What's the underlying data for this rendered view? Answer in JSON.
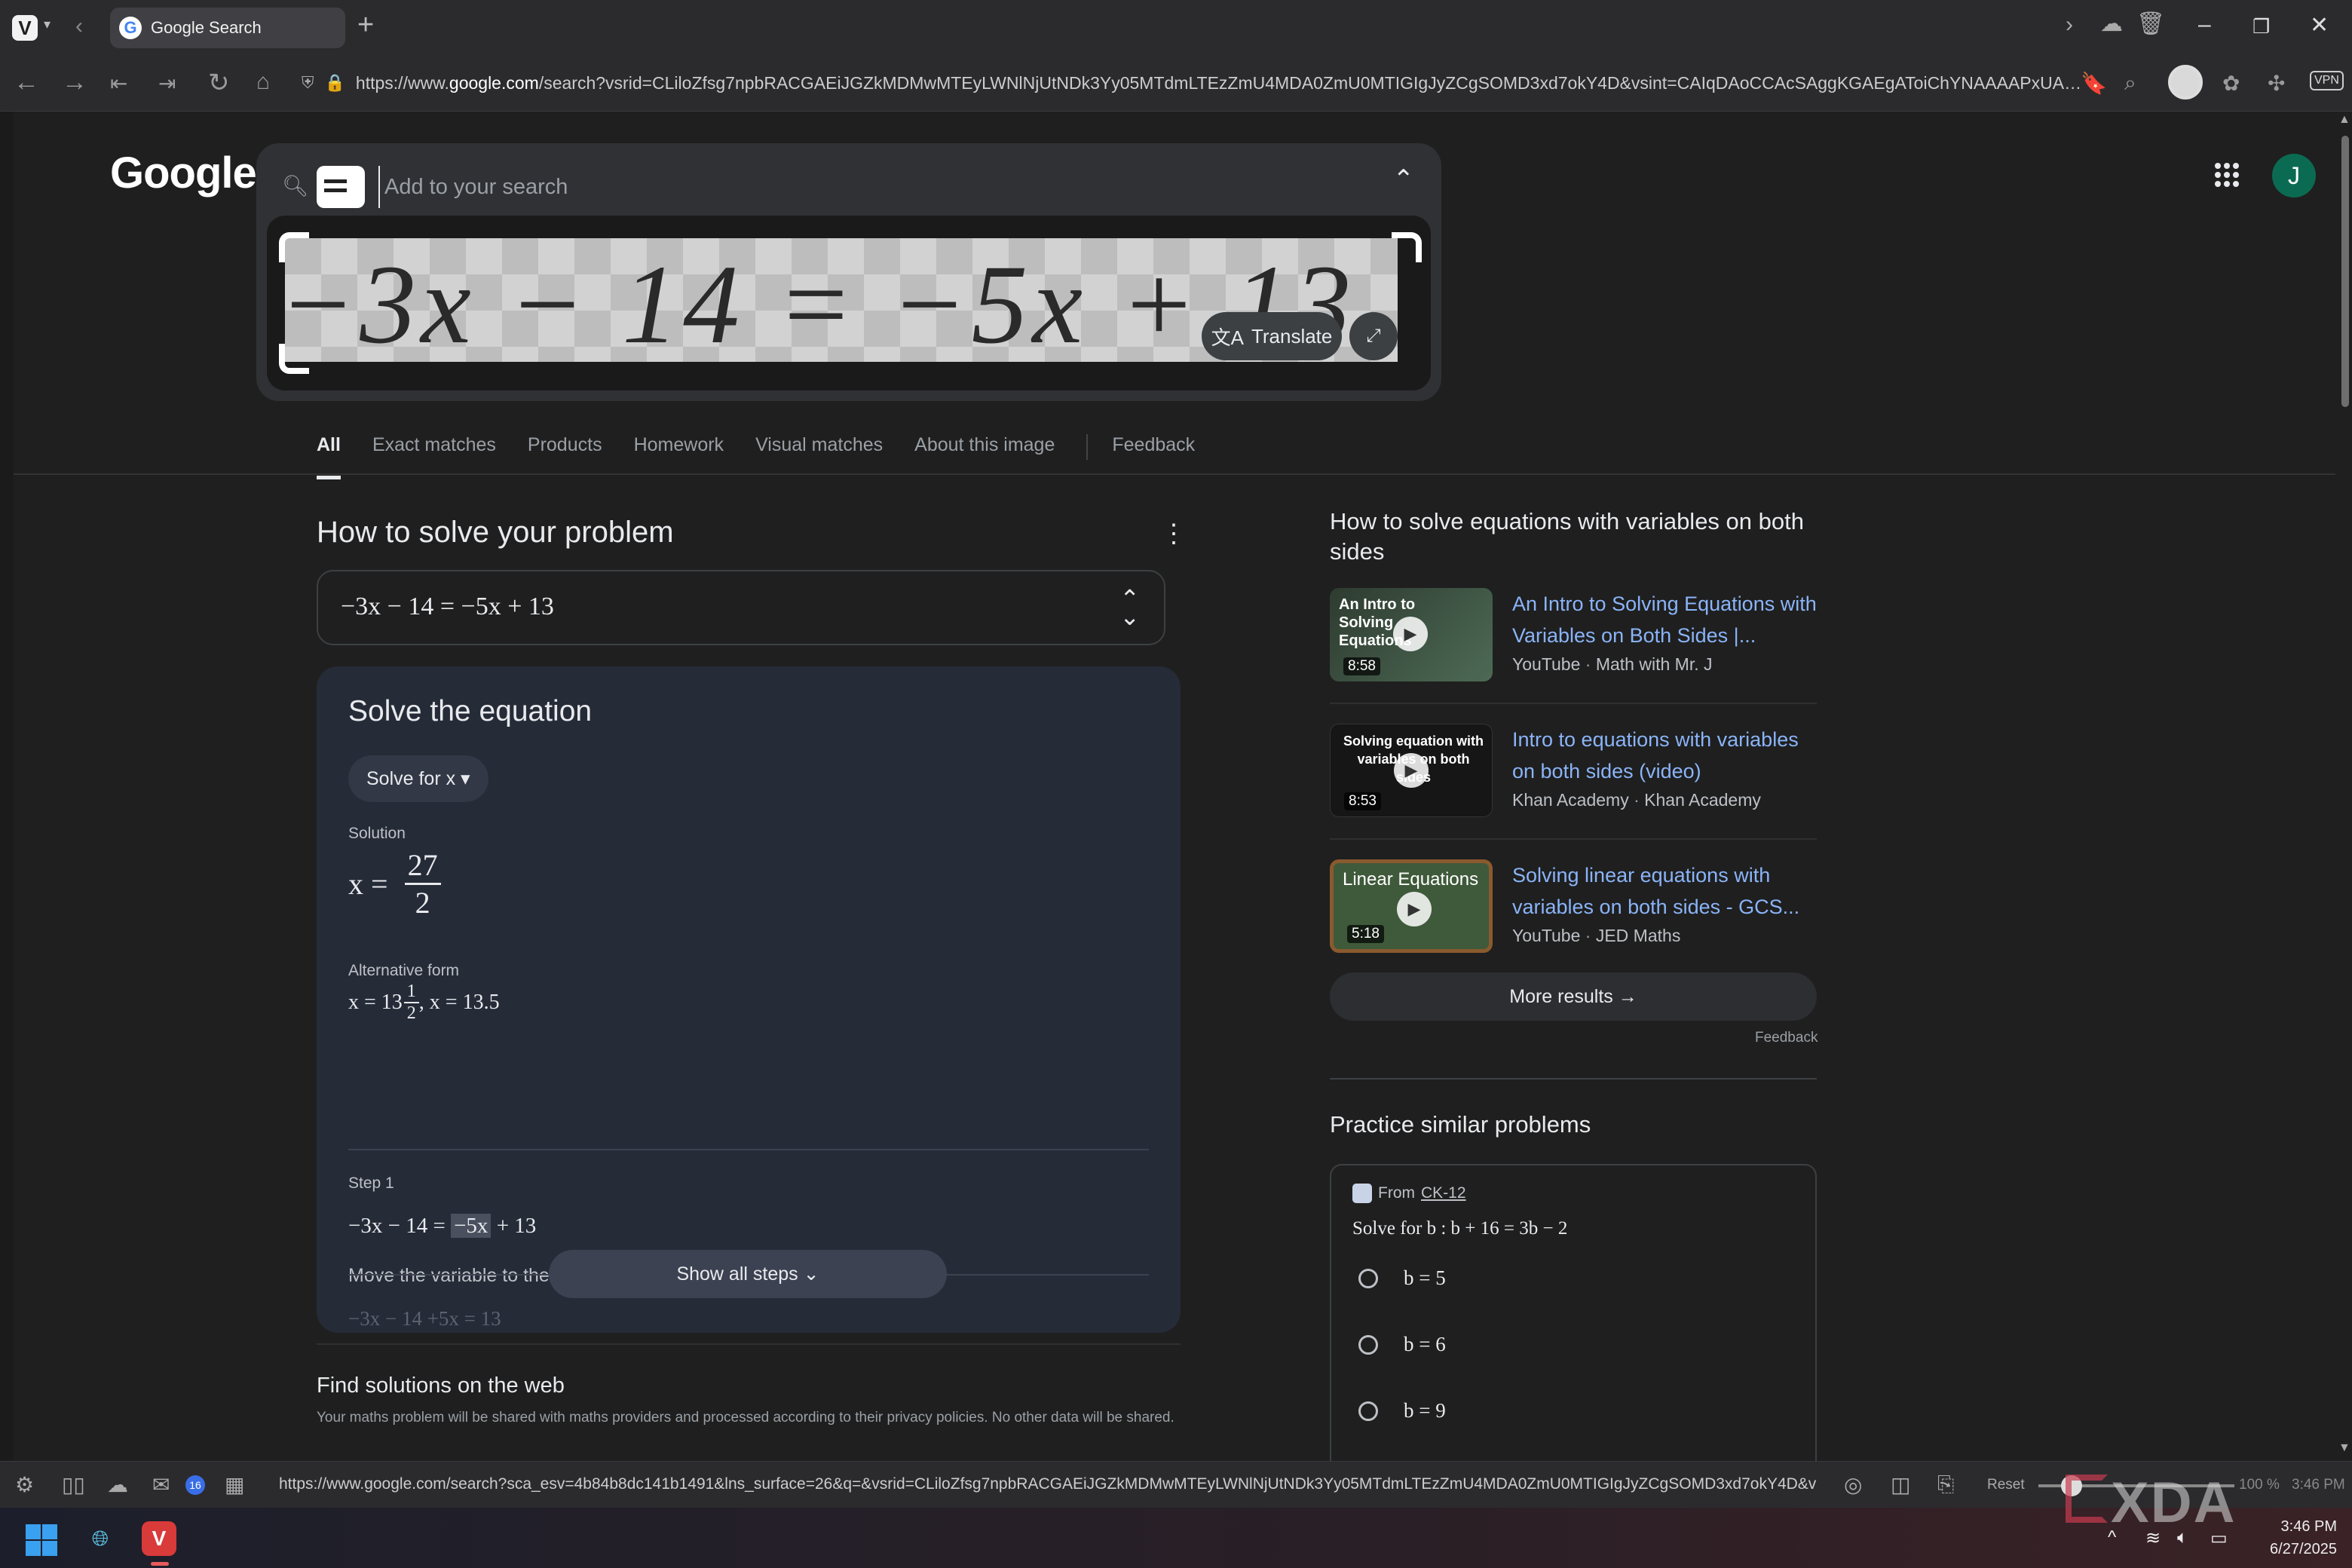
{
  "browser": {
    "tab_title": "Google Search",
    "url_prefix": "https://www.",
    "url_host": "google.com",
    "url_rest": "/search?vsrid=CLiloZfsg7npbRACGAEiJGZkMDMwMTEyLWNlNjUtNDk3Yy05MTdmLTEzZmU4MDA0ZmU0MTIGIgJyZCgSOMD3xd7okY4D&vsint=CAIqDAoCCAcSAggKGAEgAToiChYNAAAAPxUAAAA_H...",
    "status_url": "https://www.google.com/search?sca_esv=4b84b8dc141b1491&lns_surface=26&q=&vsrid=CLiloZfsg7npbRACGAEiJGZkMDMwMTEyLWNlNjUtNDk3Yy05MTdmLTEzZmU4MDA0ZmU0MTIGIgJyZCgSOMD3xd7okY4D&vsint=CAIqDA...",
    "mail_badge": "16",
    "reset_label": "Reset",
    "zoom": "100 %",
    "status_time": "3:46 PM",
    "vpn_label": "VPN"
  },
  "google": {
    "logo": "Google",
    "search_placeholder": "Add to your search",
    "image_text": "−3x − 14 = −5x + 13",
    "translate_label": "Translate",
    "avatar_letter": "J"
  },
  "tabs": [
    {
      "label": "All",
      "active": true
    },
    {
      "label": "Exact matches"
    },
    {
      "label": "Products"
    },
    {
      "label": "Homework"
    },
    {
      "label": "Visual matches"
    },
    {
      "label": "About this image"
    },
    {
      "label": "Feedback"
    }
  ],
  "solver": {
    "heading": "How to solve your problem",
    "equation": "−3x − 14 = −5x + 13",
    "card_title": "Solve the equation",
    "solve_for_label": "Solve for x",
    "solution_label": "Solution",
    "solution_lhs": "x =",
    "solution_num": "27",
    "solution_den": "2",
    "alt_label": "Alternative form",
    "alt_whole": "x = 13",
    "alt_num": "1",
    "alt_den": "2",
    "alt_rest": ", x = 13.5",
    "step_label": "Step 1",
    "step_eq_a": "−3x − 14 = ",
    "step_eq_hl": "−5x",
    "step_eq_b": " + 13",
    "step_desc": "Move the variable to the left-hand side and change its sign",
    "step_next": "−3x − 14 +5x = 13",
    "show_steps_label": "Show all steps"
  },
  "web": {
    "heading": "Find solutions on the web",
    "disclaimer": "Your maths problem will be shared with maths providers and processed according to their privacy policies. No other data will be shared."
  },
  "videos": {
    "heading": "How to solve equations with variables on both sides",
    "items": [
      {
        "title": "An Intro to Solving Equations with Variables on Both Sides |...",
        "source": "YouTube",
        "channel": "Math with Mr. J",
        "duration": "8:58",
        "thumb_text": "An Intro to Solving Equations",
        "thumb_color": "#3b4a3c"
      },
      {
        "title": "Intro to equations with variables on both sides (video)",
        "source": "Khan Academy",
        "channel": "Khan Academy",
        "duration": "8:53",
        "thumb_text": "Solving equation with variables on both sides",
        "thumb_color": "#1a1a1a"
      },
      {
        "title": "Solving linear equations with variables on both sides - GCS...",
        "source": "YouTube",
        "channel": "JED Maths",
        "duration": "5:18",
        "thumb_text": "Linear Equations",
        "thumb_color": "#3f5a3a"
      }
    ],
    "more_label": "More results",
    "feedback_label": "Feedback"
  },
  "practice": {
    "heading": "Practice similar problems",
    "from_label": "From",
    "from_source": "CK-12",
    "question": "Solve for b : b + 16 = 3b − 2",
    "options": [
      "b = 5",
      "b = 6",
      "b = 9"
    ]
  },
  "taskbar": {
    "time": "3:46 PM",
    "date": "6/27/2025"
  },
  "watermark": "XDA"
}
